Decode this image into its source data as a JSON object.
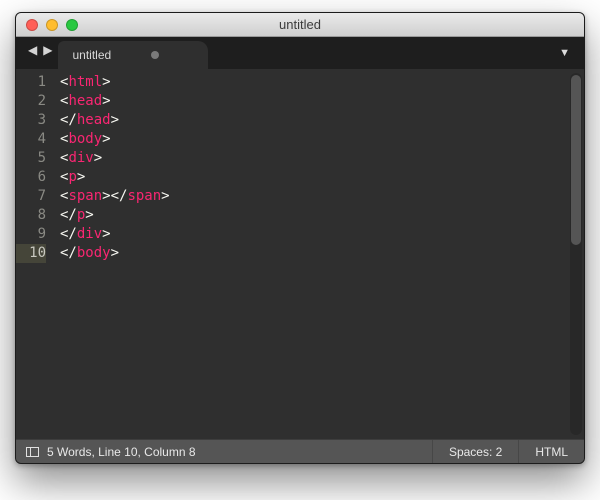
{
  "window": {
    "title": "untitled"
  },
  "tabs": {
    "items": [
      {
        "label": "untitled",
        "modified": true
      }
    ]
  },
  "editor": {
    "active_line": 10,
    "lines": [
      {
        "num": "1",
        "tokens": [
          [
            "pn",
            "<"
          ],
          [
            "tg",
            "html"
          ],
          [
            "pn",
            ">"
          ]
        ]
      },
      {
        "num": "2",
        "tokens": [
          [
            "pn",
            "<"
          ],
          [
            "tg",
            "head"
          ],
          [
            "pn",
            ">"
          ]
        ]
      },
      {
        "num": "3",
        "tokens": [
          [
            "pn",
            "</"
          ],
          [
            "tg",
            "head"
          ],
          [
            "pn",
            ">"
          ]
        ]
      },
      {
        "num": "4",
        "tokens": [
          [
            "pn",
            "<"
          ],
          [
            "tg",
            "body"
          ],
          [
            "pn",
            ">"
          ]
        ]
      },
      {
        "num": "5",
        "tokens": [
          [
            "pn",
            "<"
          ],
          [
            "tg",
            "div"
          ],
          [
            "pn",
            ">"
          ]
        ]
      },
      {
        "num": "6",
        "tokens": [
          [
            "pn",
            "<"
          ],
          [
            "tg",
            "p"
          ],
          [
            "pn",
            ">"
          ]
        ]
      },
      {
        "num": "7",
        "tokens": [
          [
            "pn",
            "<"
          ],
          [
            "tg",
            "span"
          ],
          [
            "pn",
            "></"
          ],
          [
            "tg",
            "span"
          ],
          [
            "pn",
            ">"
          ]
        ]
      },
      {
        "num": "8",
        "tokens": [
          [
            "pn",
            "</"
          ],
          [
            "tg",
            "p"
          ],
          [
            "pn",
            ">"
          ]
        ]
      },
      {
        "num": "9",
        "tokens": [
          [
            "pn",
            "</"
          ],
          [
            "tg",
            "div"
          ],
          [
            "pn",
            ">"
          ]
        ]
      },
      {
        "num": "10",
        "tokens": [
          [
            "pn",
            "</"
          ],
          [
            "tg",
            "body"
          ],
          [
            "pn",
            ">"
          ]
        ]
      }
    ]
  },
  "status": {
    "info": "5 Words, Line 10, Column 8",
    "indent": "Spaces: 2",
    "syntax": "HTML"
  },
  "nav": {
    "back": "◀",
    "forward": "▶",
    "dropdown": "▼"
  }
}
